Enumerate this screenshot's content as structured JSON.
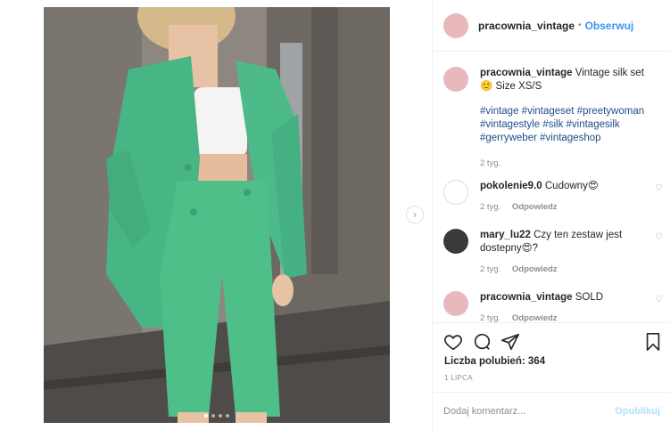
{
  "post": {
    "username": "pracownia_vintage",
    "separator": "•",
    "follow_label": "Obserwuj",
    "image_alt_icon": "photo-carousel",
    "carousel_count": 4,
    "carousel_active": 1
  },
  "caption": {
    "username": "pracownia_vintage",
    "text": "Vintage silk set 🙂 Size XS/S",
    "hashtags": "#vintage #vintageset #preetywoman #vintagestyle #silk #vintagesilk #gerryweber #vintageshop",
    "time": "2 tyg."
  },
  "comments": [
    {
      "username": "pokolenie9.0",
      "text": "Cudowny😍",
      "time": "2 tyg.",
      "reply_label": "Odpowiedz"
    },
    {
      "username": "mary_lu22",
      "text": "Czy ten zestaw jest dostepny😍?",
      "time": "2 tyg.",
      "reply_label": "Odpowiedz"
    },
    {
      "username": "pracownia_vintage",
      "text": "SOLD",
      "time": "2 tyg.",
      "reply_label": "Odpowiedz"
    }
  ],
  "stats": {
    "likes_label": "Liczba polubień: 364",
    "date": "1 LIPCA"
  },
  "composer": {
    "placeholder": "Dodaj komentarz...",
    "publish_label": "Opublikuj"
  },
  "colors": {
    "accent": "#3897f0",
    "hashtag": "#1f4d8a",
    "avatar_pink": "#e8b8ba",
    "outfit_green": "#4fbf8a"
  }
}
